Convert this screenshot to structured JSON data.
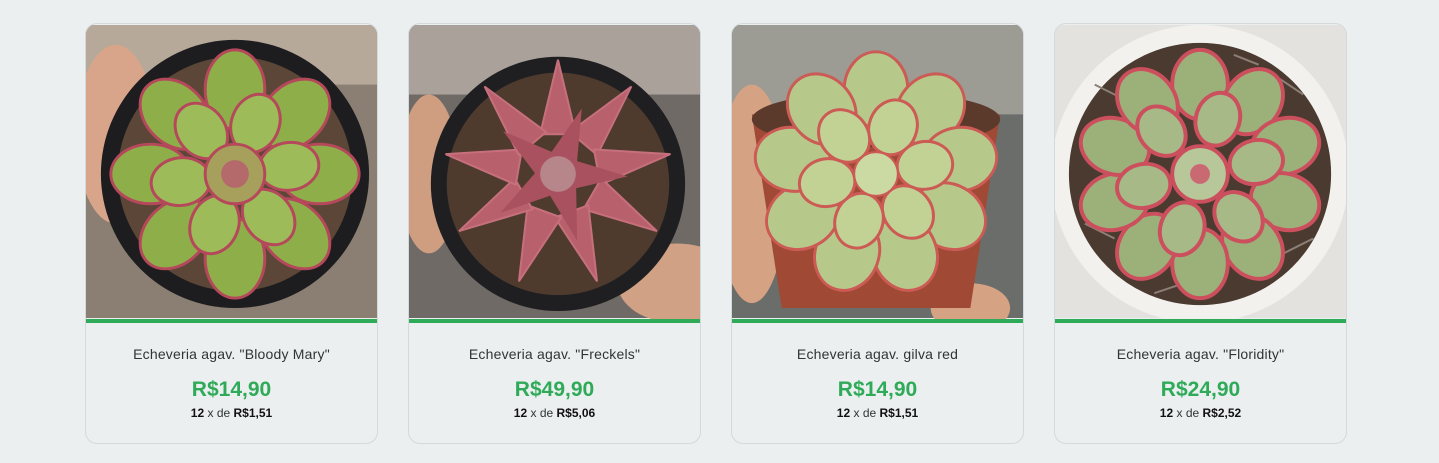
{
  "colors": {
    "accent": "#2eaa58",
    "background": "#ebeff0"
  },
  "products": [
    {
      "name": "Echeveria agav. \"Bloody Mary\"",
      "price": "R$14,90",
      "installments_count": "12",
      "installments_sep": "x de",
      "installment_value": "R$1,51",
      "image_icon": "succulent-photo"
    },
    {
      "name": "Echeveria agav. \"Freckels\"",
      "price": "R$49,90",
      "installments_count": "12",
      "installments_sep": "x de",
      "installment_value": "R$5,06",
      "image_icon": "succulent-photo"
    },
    {
      "name": "Echeveria agav. gilva red",
      "price": "R$14,90",
      "installments_count": "12",
      "installments_sep": "x de",
      "installment_value": "R$1,51",
      "image_icon": "succulent-photo"
    },
    {
      "name": "Echeveria agav. \"Floridity\"",
      "price": "R$24,90",
      "installments_count": "12",
      "installments_sep": "x de",
      "installment_value": "R$2,52",
      "image_icon": "succulent-photo"
    }
  ]
}
